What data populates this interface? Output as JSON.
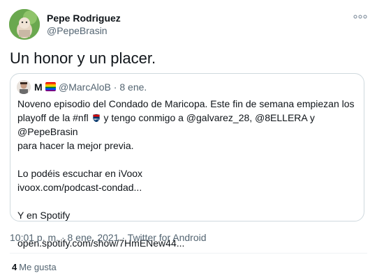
{
  "author": {
    "name": "Pepe Rodriguez",
    "handle": "@PepeBrasin"
  },
  "tweet_text": "Un honor y un placer.",
  "quoted": {
    "name_prefix": "M",
    "handle": "@MarcAloB",
    "separator": "·",
    "date": "8 ene.",
    "line1": "Noveno episodio del Condado de Maricopa. Este fin de semana empiezan los",
    "line2a": "playoff de la #nfl",
    "line2b": "y tengo conmigo a @galvarez_28, @8ELLERA y @PepeBrasin",
    "line3": "para hacer la mejor previa.",
    "line4": "Lo podéis escuchar en iVoox",
    "line5": "ivoox.com/podcast-condad...",
    "line6": "Y en Spotify",
    "line7": "open.spotify.com/show/7HmENew44..."
  },
  "meta": {
    "time": "10:01 p. m.",
    "sep": "·",
    "date": "8 ene. 2021",
    "source": "Twitter for Android"
  },
  "likes": {
    "count": "4",
    "label": "Me gusta"
  },
  "colors": {
    "text": "#0f1419",
    "muted": "#536471",
    "border": "#cfd9de"
  },
  "icons": {
    "more": "more-horizontal-icon",
    "rainbow": "rainbow-flag-icon",
    "nfl": "nfl-shield-icon"
  }
}
